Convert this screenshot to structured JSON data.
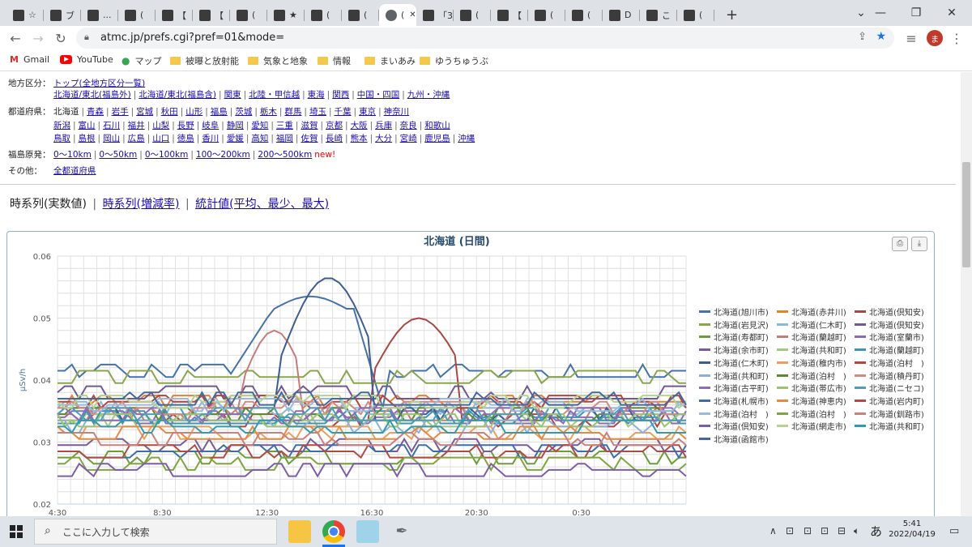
{
  "browser": {
    "tabs": [
      {
        "fav": "",
        "label": "☆"
      },
      {
        "fav": "",
        "label": "ブ"
      },
      {
        "fav": "",
        "label": "..."
      },
      {
        "fav": "",
        "label": "("
      },
      {
        "fav": "",
        "label": "【"
      },
      {
        "fav": "",
        "label": "【"
      },
      {
        "fav": "",
        "label": "("
      },
      {
        "fav": "",
        "label": "★"
      },
      {
        "fav": "",
        "label": "("
      },
      {
        "fav": "",
        "label": "("
      },
      {
        "fav": "",
        "label": "("
      },
      {
        "fav": "",
        "label": "「3"
      },
      {
        "fav": "",
        "label": "("
      },
      {
        "fav": "",
        "label": "【"
      },
      {
        "fav": "",
        "label": "("
      },
      {
        "fav": "",
        "label": "("
      },
      {
        "fav": "",
        "label": "D"
      },
      {
        "fav": "",
        "label": "こ"
      },
      {
        "fav": "",
        "label": "("
      }
    ],
    "new_tab": "+",
    "url": "atmc.jp/prefs.cgi?pref=01&mode=",
    "profile_initial": "ま",
    "bookmarks": [
      {
        "label": "Gmail",
        "icon": "gmail-icon"
      },
      {
        "label": "YouTube",
        "icon": "youtube-icon"
      },
      {
        "label": "マップ",
        "icon": "maps-icon"
      },
      {
        "label": "被曝と放射能",
        "icon": "folder-icon"
      },
      {
        "label": "気象と地象",
        "icon": "folder-icon"
      },
      {
        "label": "情報",
        "icon": "folder-icon"
      },
      {
        "label": "まいあみ",
        "icon": "folder-icon"
      },
      {
        "label": "ゆうちゅうぶ",
        "icon": "folder-icon"
      }
    ]
  },
  "nav": {
    "region_label": "地方区分：",
    "region_top": "トップ(全地方区分一覧)",
    "regions": [
      "北海道/東北(福島外)",
      "北海道/東北(福島含)",
      "関東",
      "北陸・甲信越",
      "東海",
      "関西",
      "中国・四国",
      "九州・沖縄"
    ],
    "pref_label": "都道府県：",
    "pref_current": "北海道",
    "prefs_row1": [
      "青森",
      "岩手",
      "宮城",
      "秋田",
      "山形",
      "福島",
      "茨城",
      "栃木",
      "群馬",
      "埼玉",
      "千葉",
      "東京",
      "神奈川"
    ],
    "prefs_row2": [
      "新潟",
      "富山",
      "石川",
      "福井",
      "山梨",
      "長野",
      "岐阜",
      "静岡",
      "愛知",
      "三重",
      "滋賀",
      "京都",
      "大阪",
      "兵庫",
      "奈良",
      "和歌山"
    ],
    "prefs_row3": [
      "鳥取",
      "島根",
      "岡山",
      "広島",
      "山口",
      "徳島",
      "香川",
      "愛媛",
      "高知",
      "福岡",
      "佐賀",
      "長崎",
      "熊本",
      "大分",
      "宮崎",
      "鹿児島",
      "沖縄"
    ],
    "fuku_label": "福島原発：",
    "fuku": [
      "0～10km",
      "0～50km",
      "0～100km",
      "100～200km",
      "200～500km"
    ],
    "new_tag": "new!",
    "other_label": "その他：",
    "other": "全都道府県"
  },
  "view_tabs": {
    "current": "時系列(実数値)",
    "link1": "時系列(増減率)",
    "link2": "統計値(平均、最少、最大)"
  },
  "chart_data": {
    "type": "line",
    "title": "北海道 (日間)",
    "ylabel": "μSv/h",
    "ylim": [
      0.02,
      0.06
    ],
    "yticks": [
      "0.06",
      "0.05",
      "0.04",
      "0.03",
      "0.02"
    ],
    "xticks": [
      "4:30",
      "8:30",
      "12:30",
      "16:30",
      "20:30",
      "0:30"
    ],
    "legend_placement": "right",
    "grid": true,
    "series": [
      {
        "name": "北海道(旭川市)",
        "color": "#4572a7"
      },
      {
        "name": "北海道(赤井川)",
        "color": "#e9802c"
      },
      {
        "name": "北海道(倶知安)",
        "color": "#aa4643"
      },
      {
        "name": "北海道(岩見沢)",
        "color": "#89a54e"
      },
      {
        "name": "北海道(仁木町)",
        "color": "#8bb7d9"
      },
      {
        "name": "北海道(倶知安)",
        "color": "#71588f"
      },
      {
        "name": "北海道(寿都町)",
        "color": "#6e9c3b"
      },
      {
        "name": "北海道(蘭越町)",
        "color": "#c67b79"
      },
      {
        "name": "北海道(室蘭市)",
        "color": "#8a6db0"
      },
      {
        "name": "北海道(余市町)",
        "color": "#7a5b99"
      },
      {
        "name": "北海道(共和町)",
        "color": "#a7c780"
      },
      {
        "name": "北海道(蘭越町)",
        "color": "#3d96ae"
      },
      {
        "name": "北海道(仁木町)",
        "color": "#3b5e8e"
      },
      {
        "name": "北海道(稚内市)",
        "color": "#e9a05c"
      },
      {
        "name": "北海道(泊村　)",
        "color": "#b5463f"
      },
      {
        "name": "北海道(共和町)",
        "color": "#8fb0d6"
      },
      {
        "name": "北海道(泊村　)",
        "color": "#5d8a2e"
      },
      {
        "name": "北海道(積丹町)",
        "color": "#d38a85"
      },
      {
        "name": "北海道(古平町)",
        "color": "#8e6bb8"
      },
      {
        "name": "北海道(帯広市)",
        "color": "#9ac46d"
      },
      {
        "name": "北海道(ニセコ)",
        "color": "#4aa0ba"
      },
      {
        "name": "北海道(札幌市)",
        "color": "#3e6ea8"
      },
      {
        "name": "北海道(神恵内)",
        "color": "#e88a3e"
      },
      {
        "name": "北海道(岩内町)",
        "color": "#b24a43"
      },
      {
        "name": "北海道(泊村　)",
        "color": "#97bbe0"
      },
      {
        "name": "北海道(泊村　)",
        "color": "#7fa53f"
      },
      {
        "name": "北海道(釧路市)",
        "color": "#c9807e"
      },
      {
        "name": "北海道(倶知安)",
        "color": "#7d5ea6"
      },
      {
        "name": "北海道(網走市)",
        "color": "#b2d48f"
      },
      {
        "name": "北海道(共和町)",
        "color": "#2f9bb0"
      },
      {
        "name": "北海道(函館市)",
        "color": "#44679e"
      }
    ]
  },
  "taskbar": {
    "search_placeholder": "ここに入力して検索",
    "time": "5:41",
    "date": "2022/04/19",
    "ime": "あ"
  }
}
